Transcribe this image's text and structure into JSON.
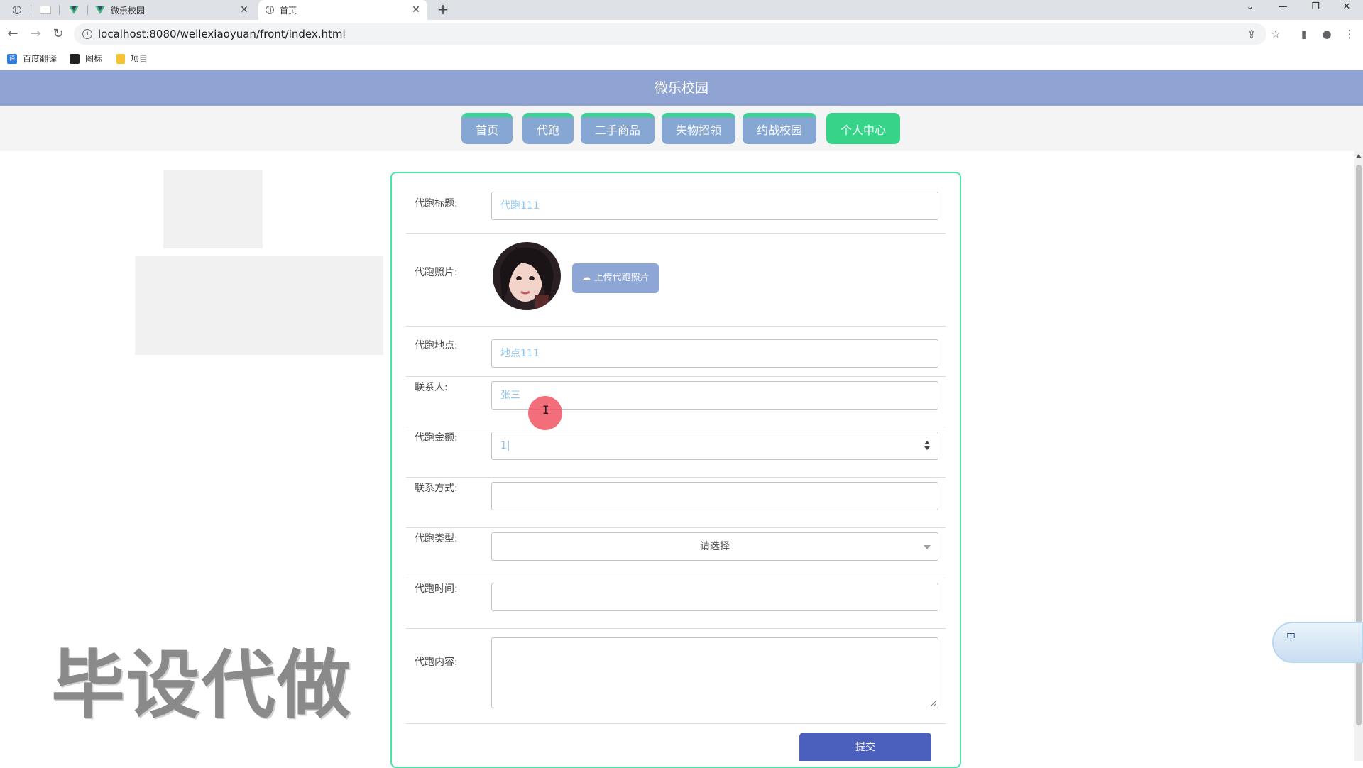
{
  "browser": {
    "tabs": [
      {
        "label": "微乐校园",
        "active": false
      },
      {
        "label": "首页",
        "active": true
      }
    ],
    "url": "localhost:8080/weilexiaoyuan/front/index.html",
    "bookmarks": [
      {
        "label": "百度翻译",
        "icon": "baidu-translate-icon"
      },
      {
        "label": "图标",
        "icon": "icon-folder-icon"
      },
      {
        "label": "项目",
        "icon": "folder-icon"
      }
    ]
  },
  "site": {
    "title": "微乐校园",
    "nav": [
      {
        "label": "首页",
        "active": false
      },
      {
        "label": "代跑",
        "active": false
      },
      {
        "label": "二手商品",
        "active": false
      },
      {
        "label": "失物招领",
        "active": false
      },
      {
        "label": "约战校园",
        "active": false
      },
      {
        "label": "个人中心",
        "active": true
      }
    ]
  },
  "form": {
    "title_label": "代跑标题:",
    "title_value": "代跑111",
    "photo_label": "代跑照片:",
    "upload_label": "上传代跑照片",
    "location_label": "代跑地点:",
    "location_value": "地点111",
    "contact_label": "联系人:",
    "contact_value": "张三",
    "amount_label": "代跑金额:",
    "amount_value": "1|",
    "phone_label": "联系方式:",
    "phone_value": "",
    "type_label": "代跑类型:",
    "type_placeholder": "请选择",
    "time_label": "代跑时间:",
    "time_value": "",
    "content_label": "代跑内容:",
    "content_value": "",
    "submit_label": "提交"
  },
  "overlay": {
    "watermark": "毕设代做",
    "ime_label": "中"
  },
  "colors": {
    "header": "#90a4d3",
    "nav_inactive": "#86a6d4",
    "nav_active": "#36d389",
    "card_border": "#4fe2a5",
    "submit": "#4b5fbc"
  }
}
